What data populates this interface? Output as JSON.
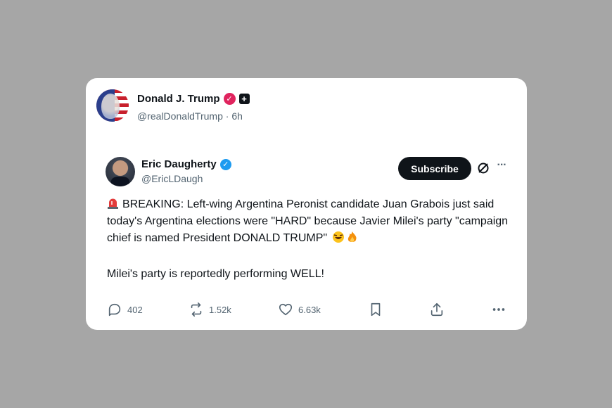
{
  "post": {
    "author_name": "Donald J. Trump",
    "author_handle": "@realDonaldTrump",
    "separator": "·",
    "timestamp": "6h"
  },
  "quoted": {
    "author_name": "Eric Daugherty",
    "author_handle": "@EricLDaugh",
    "subscribe_label": "Subscribe",
    "text_line1": "BREAKING: Left-wing Argentina Peronist candidate Juan Grabois just said today's Argentina elections were \"HARD\" because Javier Milei's party \"campaign chief is named President DONALD TRUMP\"",
    "text_line2": "Milei's party is reportedly performing WELL!"
  },
  "actions": {
    "replies": "402",
    "reposts": "1.52k",
    "likes": "6.63k"
  },
  "colors": {
    "background": "#a6a6a6",
    "card": "#ffffff",
    "text": "#0f1419",
    "secondary_text": "#536471",
    "verified_pink": "#e0245e",
    "verified_blue": "#1d9bf0"
  },
  "icons": {
    "siren": "police-siren-emoji",
    "laugh": "rolling-on-floor-laughing-emoji",
    "fire": "fire-emoji"
  }
}
